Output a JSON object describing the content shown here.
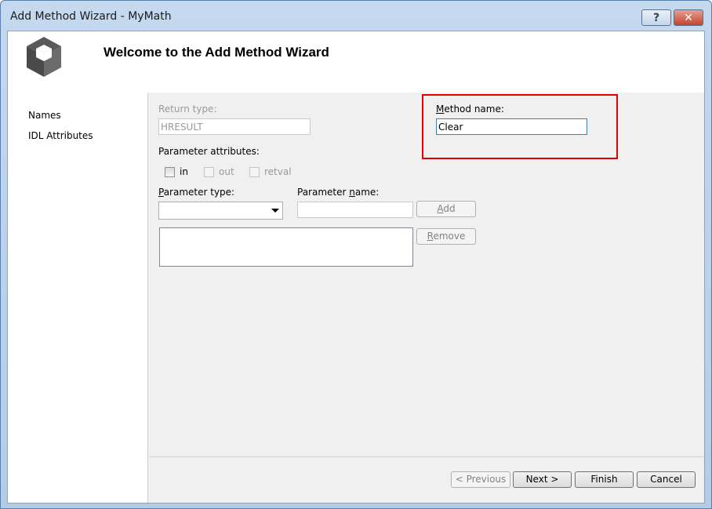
{
  "window": {
    "title": "Add Method Wizard - MyMath",
    "help_label": "?",
    "close_label": "✕"
  },
  "header": {
    "heading": "Welcome to the Add Method Wizard",
    "logo_icon": "cube-icon"
  },
  "nav": {
    "items": [
      {
        "label": "Names"
      },
      {
        "label": "IDL Attributes"
      }
    ]
  },
  "form": {
    "return_type_label": "Return type:",
    "return_type_value": "HRESULT",
    "method_name_label": "Method name:",
    "method_name_value": "Clear",
    "param_attrs_label": "Parameter attributes:",
    "attr_in": "in",
    "attr_out": "out",
    "attr_retval": "retval",
    "param_type_label": "Parameter type:",
    "param_type_value": "",
    "param_name_label": "Parameter name:",
    "param_name_value": "",
    "add_label": "Add",
    "remove_label": "Remove"
  },
  "footer": {
    "previous_label": "< Previous",
    "next_label": "Next >",
    "finish_label": "Finish",
    "cancel_label": "Cancel"
  },
  "colors": {
    "highlight": "#e00000",
    "title_bg": "#c4d8ee",
    "close_button": "#c4442e"
  }
}
